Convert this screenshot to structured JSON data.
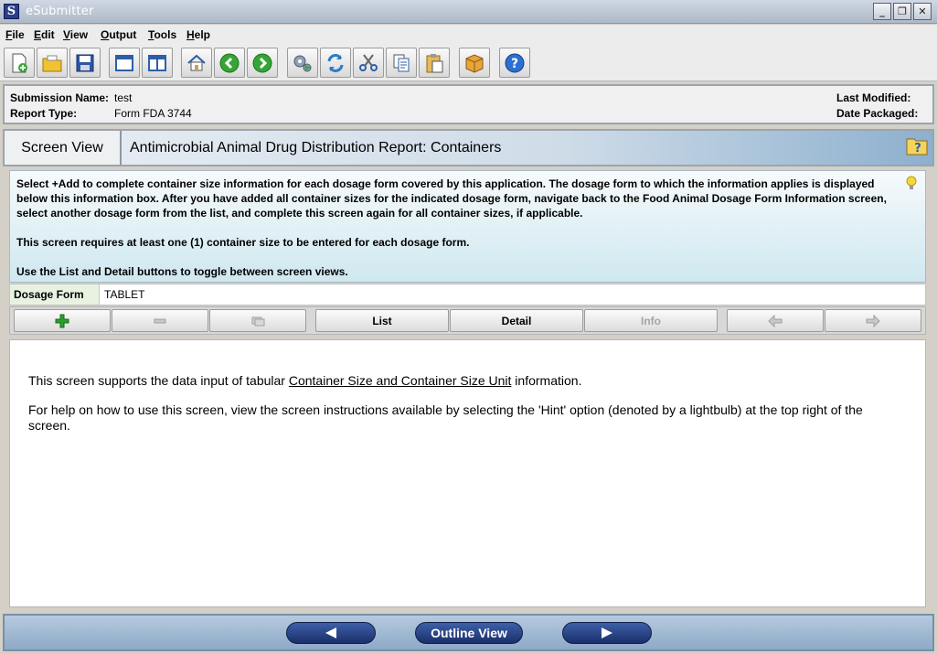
{
  "window": {
    "title": "eSubmitter",
    "app_icon_letter": "S",
    "controls": {
      "minimize": "_",
      "restore": "❐",
      "close": "✕"
    }
  },
  "menu": [
    {
      "label": "File",
      "key": "F"
    },
    {
      "label": "Edit",
      "key": "E"
    },
    {
      "label": "View",
      "key": "V"
    },
    {
      "label": "Output",
      "key": "O"
    },
    {
      "label": "Tools",
      "key": "T"
    },
    {
      "label": "Help",
      "key": "H"
    }
  ],
  "toolbar": [
    "new-document-icon",
    "open-folder-icon",
    "save-icon",
    "window-icon",
    "split-view-icon",
    "home-icon",
    "back-arrow-icon",
    "forward-arrow-icon",
    "settings-gears-icon",
    "refresh-icon",
    "cut-icon",
    "copy-icon",
    "paste-icon",
    "package-icon",
    "help-icon"
  ],
  "submission": {
    "name_label": "Submission Name:",
    "name_value": "test",
    "type_label": "Report Type:",
    "type_value": "Form FDA 3744",
    "last_modified_label": "Last Modified:",
    "date_packaged_label": "Date Packaged:"
  },
  "header": {
    "screen_view": "Screen View",
    "title": "Antimicrobial Animal Drug Distribution Report: Containers"
  },
  "instructions": {
    "para1": "Select +Add to complete container size information for each dosage form covered by this application. The dosage form to which the information applies is displayed below this information box. After you have added all container sizes for the indicated dosage form, navigate back to the Food Animal Dosage Form Information screen, select another dosage form from the list, and complete this screen again for all container sizes, if applicable.",
    "para2": "This screen requires at least one (1) container size to be entered for each dosage form.",
    "para3": "Use the List and Detail buttons to toggle between screen views."
  },
  "dosage": {
    "label": "Dosage Form",
    "value": "TABLET"
  },
  "actions": {
    "list": "List",
    "detail": "Detail",
    "info": "Info"
  },
  "content": {
    "line1_pre": "This screen supports the data input of tabular ",
    "line1_link": "Container Size and Container Size Unit",
    "line1_post": " information.",
    "line2": "For help on how to use this screen, view the screen instructions available by selecting the 'Hint' option (denoted by a lightbulb) at the top right of the screen."
  },
  "bottom_nav": {
    "outline_view": "Outline View"
  },
  "colors": {
    "accent_green": "#2e9e2e",
    "nav_blue": "#1b2f6b",
    "header_blue": "#8db0ce"
  }
}
